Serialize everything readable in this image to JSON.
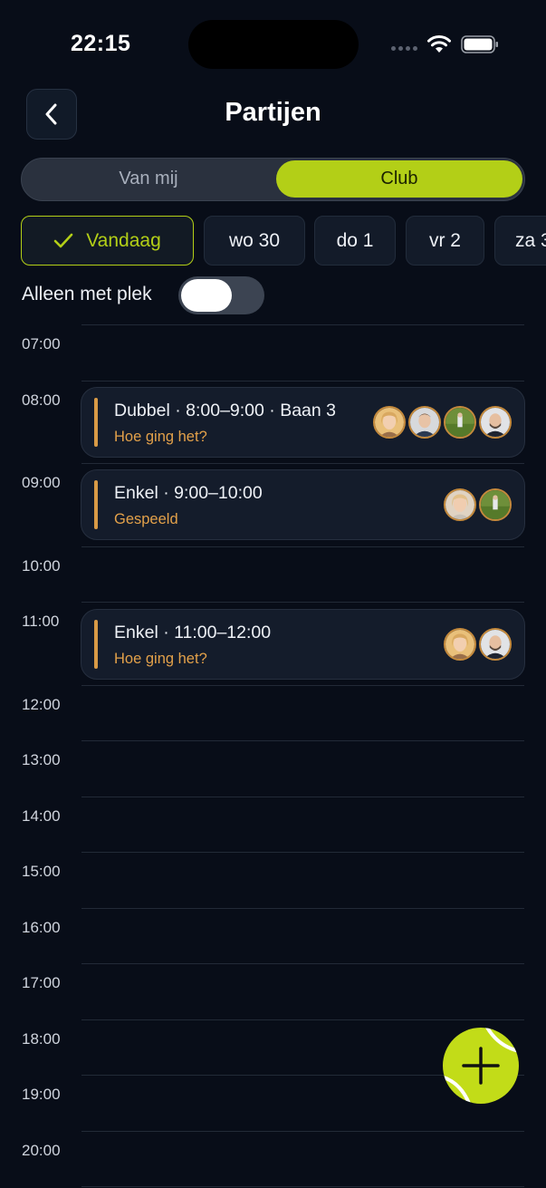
{
  "status_bar": {
    "time": "22:15"
  },
  "header": {
    "title": "Partijen"
  },
  "segmented": {
    "left": "Van mij",
    "right": "Club",
    "selected": "Club"
  },
  "date_chips": [
    {
      "label": "Vandaag",
      "active": true
    },
    {
      "label": "wo 30",
      "active": false
    },
    {
      "label": "do 1",
      "active": false
    },
    {
      "label": "vr 2",
      "active": false
    },
    {
      "label": "za 3",
      "active": false
    }
  ],
  "filter": {
    "label": "Alleen met plek",
    "on": false
  },
  "hours": [
    "07:00",
    "08:00",
    "09:00",
    "10:00",
    "11:00",
    "12:00",
    "13:00",
    "14:00",
    "15:00",
    "16:00",
    "17:00",
    "18:00",
    "19:00",
    "20:00"
  ],
  "events": [
    {
      "title": "Dubbel · 8:00–9:00 · Baan 3",
      "subtitle": "Hoe ging het?",
      "players": 4
    },
    {
      "title": "Enkel · 9:00–10:00",
      "subtitle": "Gespeeld",
      "players": 2
    },
    {
      "title": "Enkel · 11:00–12:00",
      "subtitle": "Hoe ging het?",
      "players": 2
    }
  ],
  "colors": {
    "accent": "#b3cf17",
    "event_bar": "#d89a46",
    "event_subtitle": "#e3a14a",
    "background": "#080d18"
  },
  "icons": {
    "back": "chevron-left-icon",
    "check": "checkmark-icon",
    "add": "plus-icon",
    "fab_ball": "tennis-ball-icon"
  }
}
